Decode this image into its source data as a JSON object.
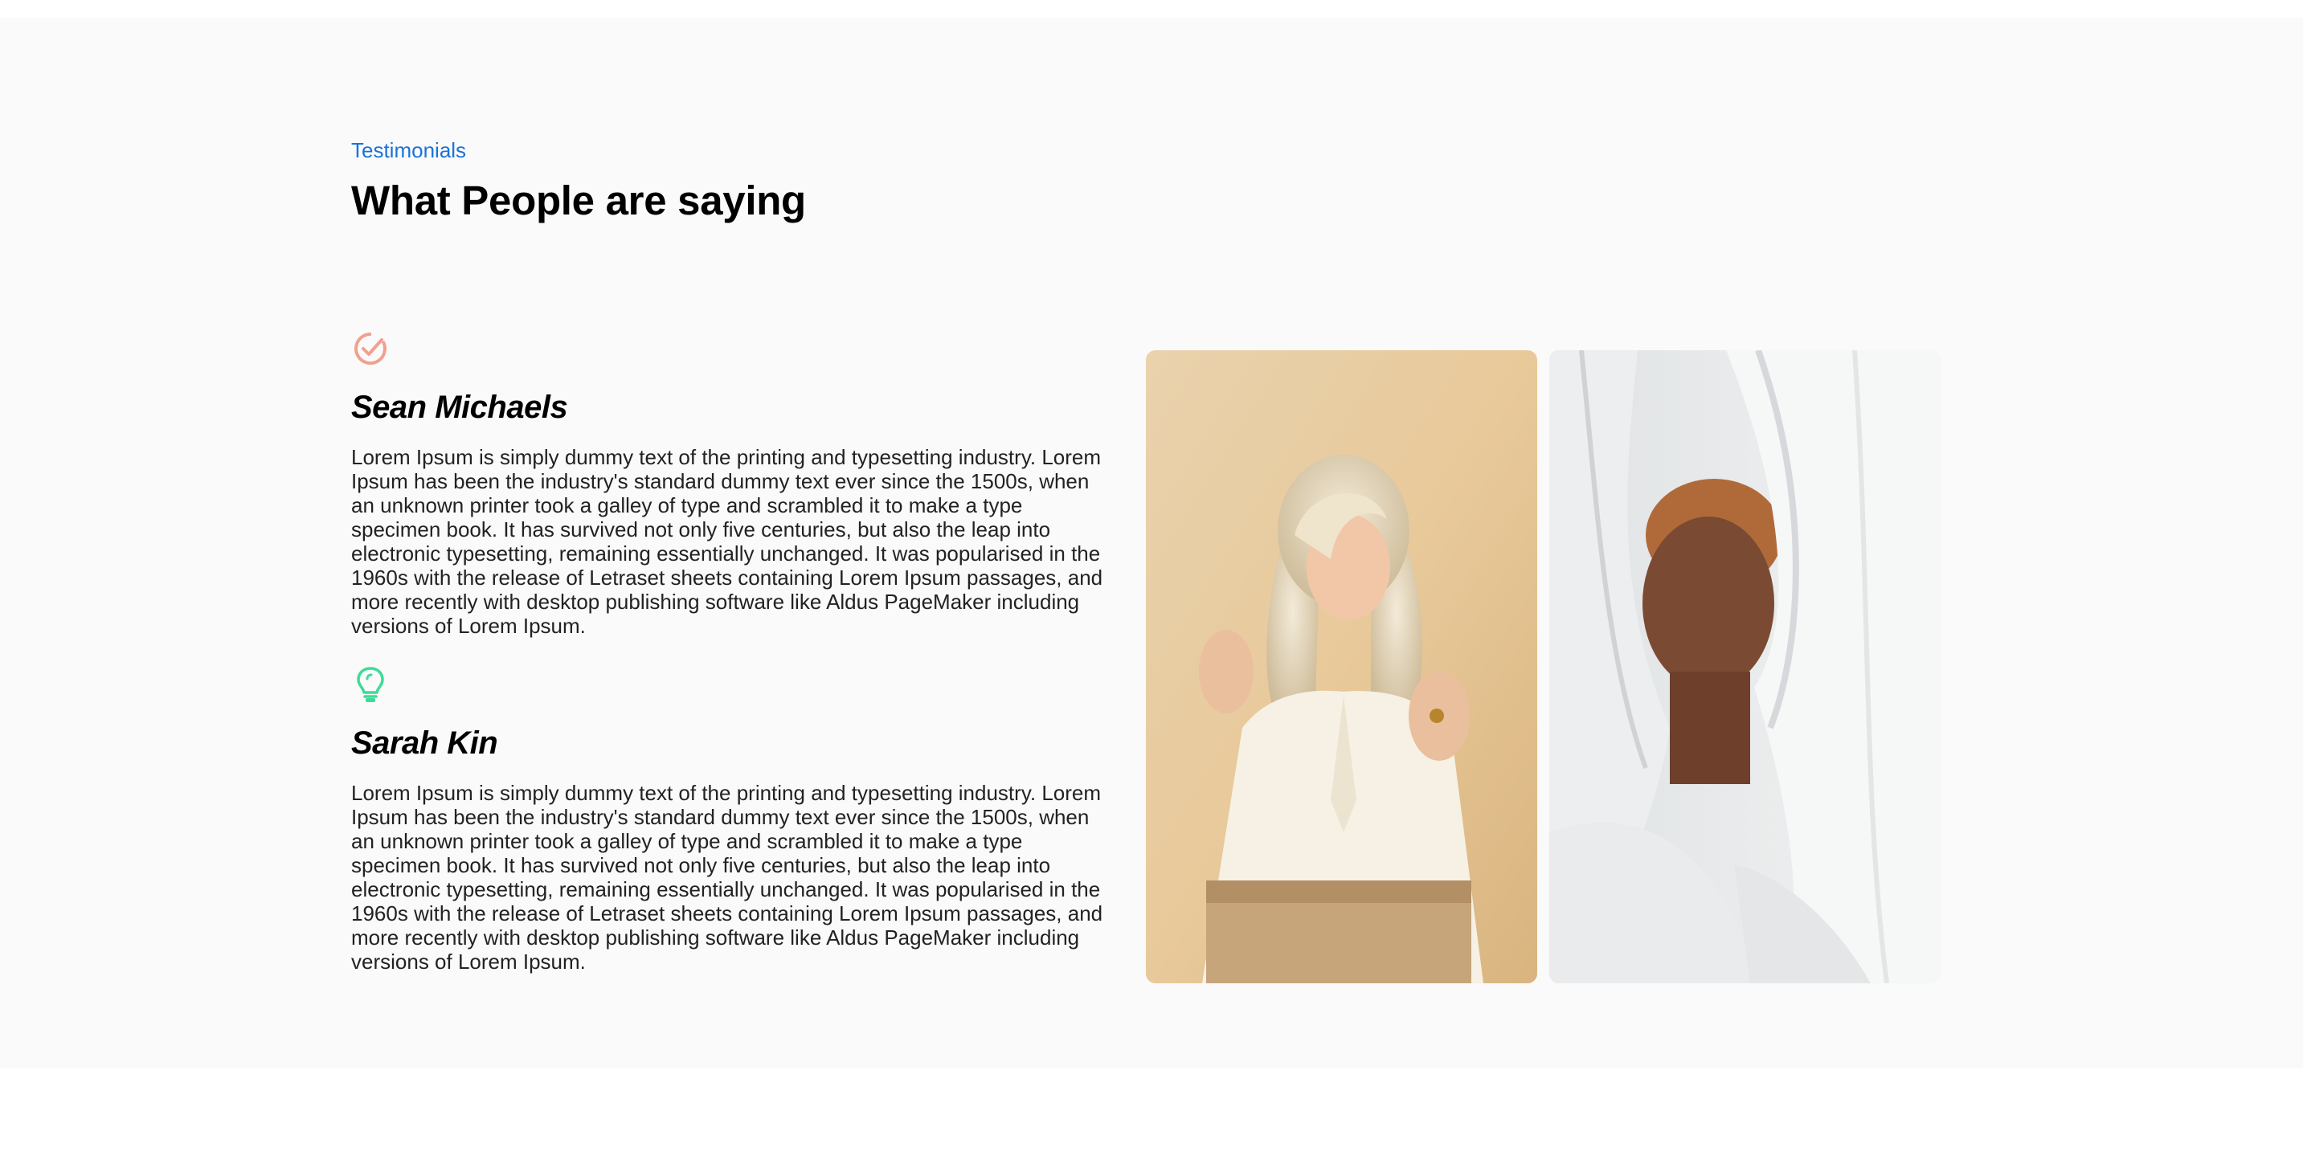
{
  "section": {
    "eyebrow": "Testimonials",
    "title": "What People are saying"
  },
  "testimonials": [
    {
      "icon": "check-circle-icon",
      "icon_color": "#f2a08f",
      "name": "Sean Michaels",
      "text": "Lorem Ipsum is simply dummy text of the printing and typesetting industry. Lorem Ipsum has been the industry's standard dummy text ever since the 1500s, when an unknown printer took a galley of type and scrambled it to make a type specimen book. It has survived not only five centuries, but also the leap into electronic typesetting, remaining essentially unchanged. It was popularised in the 1960s with the release of Letraset sheets containing Lorem Ipsum passages, and more recently with desktop publishing software like Aldus PageMaker including versions of Lorem Ipsum."
    },
    {
      "icon": "lightbulb-icon",
      "icon_color": "#3ddc97",
      "name": "Sarah Kin",
      "text": "Lorem Ipsum is simply dummy text of the printing and typesetting industry. Lorem Ipsum has been the industry's standard dummy text ever since the 1500s, when an unknown printer took a galley of type and scrambled it to make a type specimen book. It has survived not only five centuries, but also the leap into electronic typesetting, remaining essentially unchanged. It was popularised in the 1960s with the release of Letraset sheets containing Lorem Ipsum passages, and more recently with desktop publishing software like Aldus PageMaker including versions of Lorem Ipsum."
    }
  ],
  "colors": {
    "accent": "#1a73d9",
    "background": "#fafafa"
  }
}
